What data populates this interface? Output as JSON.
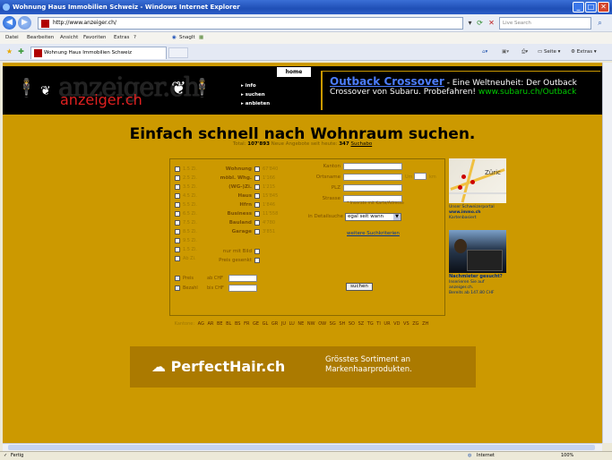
{
  "window": {
    "title": "Wohnung Haus Immobilien Schweiz - Windows Internet Explorer",
    "min": "_",
    "max": "□",
    "close": "✕"
  },
  "address": {
    "url": "http://www.anzeiger.ch/",
    "live_search_placeholder": "Live Search"
  },
  "menu": [
    "Datei",
    "Bearbeiten",
    "Ansicht",
    "Favoriten",
    "Extras",
    "?"
  ],
  "snagit": "SnagIt",
  "tab": {
    "label": "Wohnung Haus Immobilien Schweiz"
  },
  "commands": {
    "page": "Seite",
    "extras": "Extras"
  },
  "site": {
    "logo_top": "anzeiger.ch",
    "logo_bottom": "anzeiger.ch",
    "nav": {
      "home": "home",
      "info": "info",
      "suchen": "suchen",
      "anbieten": "anbieten"
    },
    "ad": {
      "title": "Outback Crossover",
      "text1": " - Eine Weltneuheit: Der Outback",
      "text2": "Crossover von Subaru. Probefahren! ",
      "url": "www.subaru.ch/Outback"
    },
    "headline": "Einfach schnell nach Wohnraum suchen.",
    "subline": {
      "prefix": "Total: ",
      "total": "107'893",
      "middle": "  Neue Angebote seit heute: ",
      "new": "347",
      "link": "Suchabo"
    },
    "rooms": [
      "1.5 Zi.",
      "2.5 Zi.",
      "3.5 Zi.",
      "4.5 Zi.",
      "5.5 Zi.",
      "6.5 Zi.",
      "7.5 Zi.",
      "8.5 Zi.",
      "9.5 Zi.",
      "1.5 Zi.",
      "Ab Zi."
    ],
    "categories": [
      {
        "label": "Wohnung",
        "count": "67'840"
      },
      {
        "label": "möbl. Whg.",
        "count": "1'166"
      },
      {
        "label": "(WG-)Zi.",
        "count": "1'215"
      },
      {
        "label": "Haus",
        "count": "15'845"
      },
      {
        "label": "Hfrn",
        "count": "1'846"
      },
      {
        "label": "Business",
        "count": "11'558"
      },
      {
        "label": "Bauland",
        "count": "4'780"
      },
      {
        "label": "Garage",
        "count": "3'851"
      }
    ],
    "extra_options": [
      "nur mit Bild",
      "Preis gesenkt"
    ],
    "price": {
      "from_label": "Preis",
      "to_label": "Bezahl",
      "from_prefix": "ab CHF",
      "to_prefix": "bis CHF"
    },
    "fields": {
      "kanton": "Kanton",
      "ortsname": "Ortsname",
      "plz": "PLZ",
      "strasse": "Strasse",
      "umkreis": "Um",
      "km": "km",
      "hint": "* Inserate mit Karte/Adresse",
      "in_detail": "in Detailsuche",
      "select_value": "egal seit wann",
      "more": "weitere Suchkriterien",
      "submit": "suchen"
    },
    "sidebar": {
      "map_city": "Züric",
      "map_text1": "Unser Schweizerportal",
      "map_text2": "www.immo.ch",
      "map_text3": "Kartenbasiert",
      "person_text1": "Nachmieter gesucht?",
      "person_text2": "Inserieren Sie auf",
      "person_text3": "anzeiger.ch.",
      "person_text4": "Bereits ab 147.80 CHF"
    },
    "cantons_label": "Kantone:",
    "cantons": [
      "AG",
      "AR",
      "BE",
      "BL",
      "BS",
      "FR",
      "GE",
      "GL",
      "GR",
      "JU",
      "LU",
      "NE",
      "NW",
      "OW",
      "SG",
      "SH",
      "SO",
      "SZ",
      "TG",
      "TI",
      "UR",
      "VD",
      "VS",
      "ZG",
      "ZH"
    ],
    "banner": {
      "logo": "PerfectHair.ch",
      "text": "Grösstes Sortiment an Markenhaarprodukten."
    }
  },
  "status": {
    "left": "Fertig",
    "zone": "Internet",
    "zoom": "100%"
  }
}
